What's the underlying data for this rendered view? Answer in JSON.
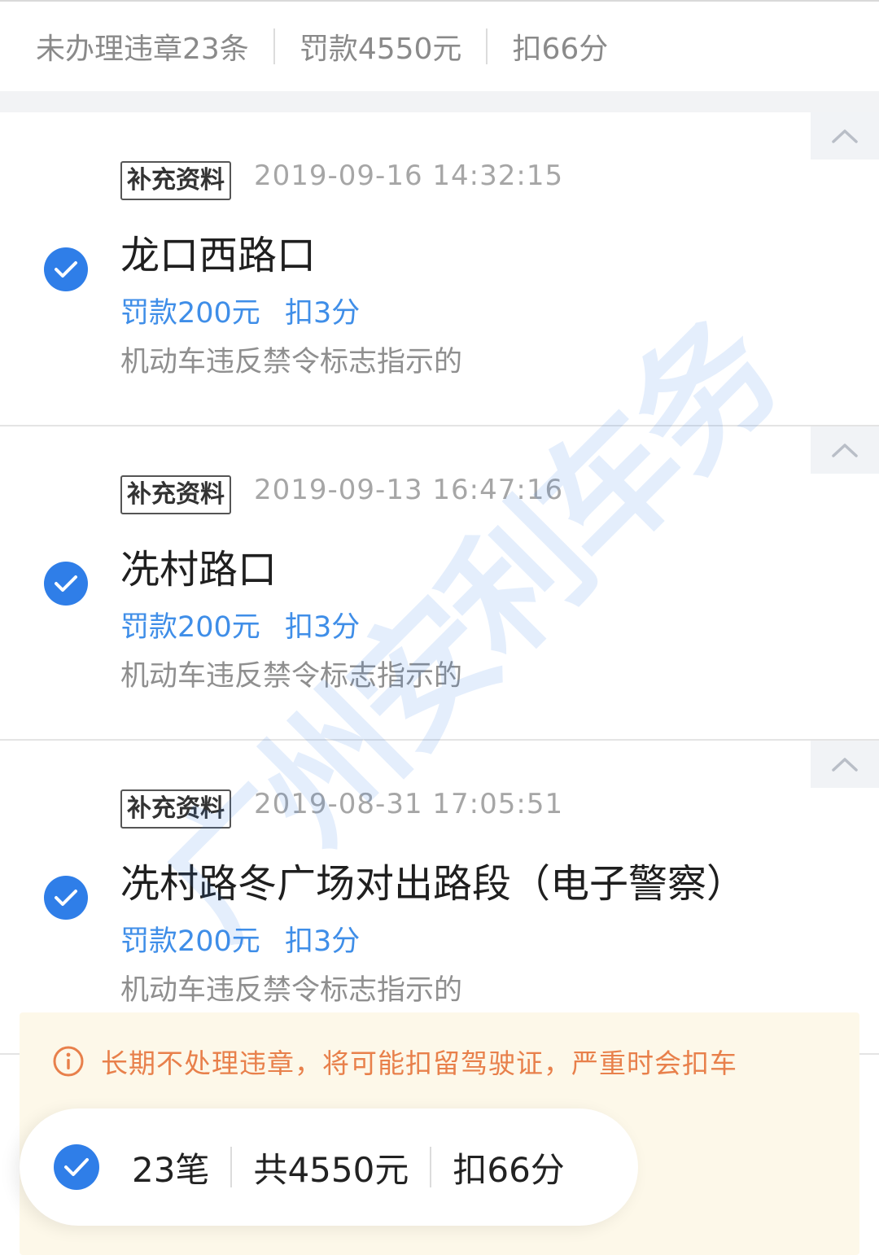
{
  "summary": {
    "unprocessed": "未办理违章23条",
    "fine_total": "罚款4550元",
    "points_total": "扣66分"
  },
  "violations": [
    {
      "badge": "补充资料",
      "time": "2019-09-16 14:32:15",
      "location": "龙口西路口",
      "fine": "罚款200元",
      "points": "扣3分",
      "description": "机动车违反禁令标志指示的"
    },
    {
      "badge": "补充资料",
      "time": "2019-09-13 16:47:16",
      "location": "冼村路口",
      "fine": "罚款200元",
      "points": "扣3分",
      "description": "机动车违反禁令标志指示的"
    },
    {
      "badge": "补充资料",
      "time": "2019-08-31 17:05:51",
      "location": "冼村路冬广场对出路段（电子警察）",
      "fine": "罚款200元",
      "points": "扣3分",
      "description": "机动车违反禁令标志指示的"
    }
  ],
  "warning": {
    "text": "长期不处理违章，将可能扣留驾驶证，严重时会扣车",
    "icon": "info-icon",
    "color": "#e8804b"
  },
  "bottom_bar": {
    "count": "23笔",
    "total": "共4550元",
    "points": "扣66分"
  },
  "watermark": "广州安利车务",
  "colors": {
    "accent": "#2f7ee8",
    "link": "#3f8ee8",
    "warning_bg": "#fdf8e9"
  }
}
